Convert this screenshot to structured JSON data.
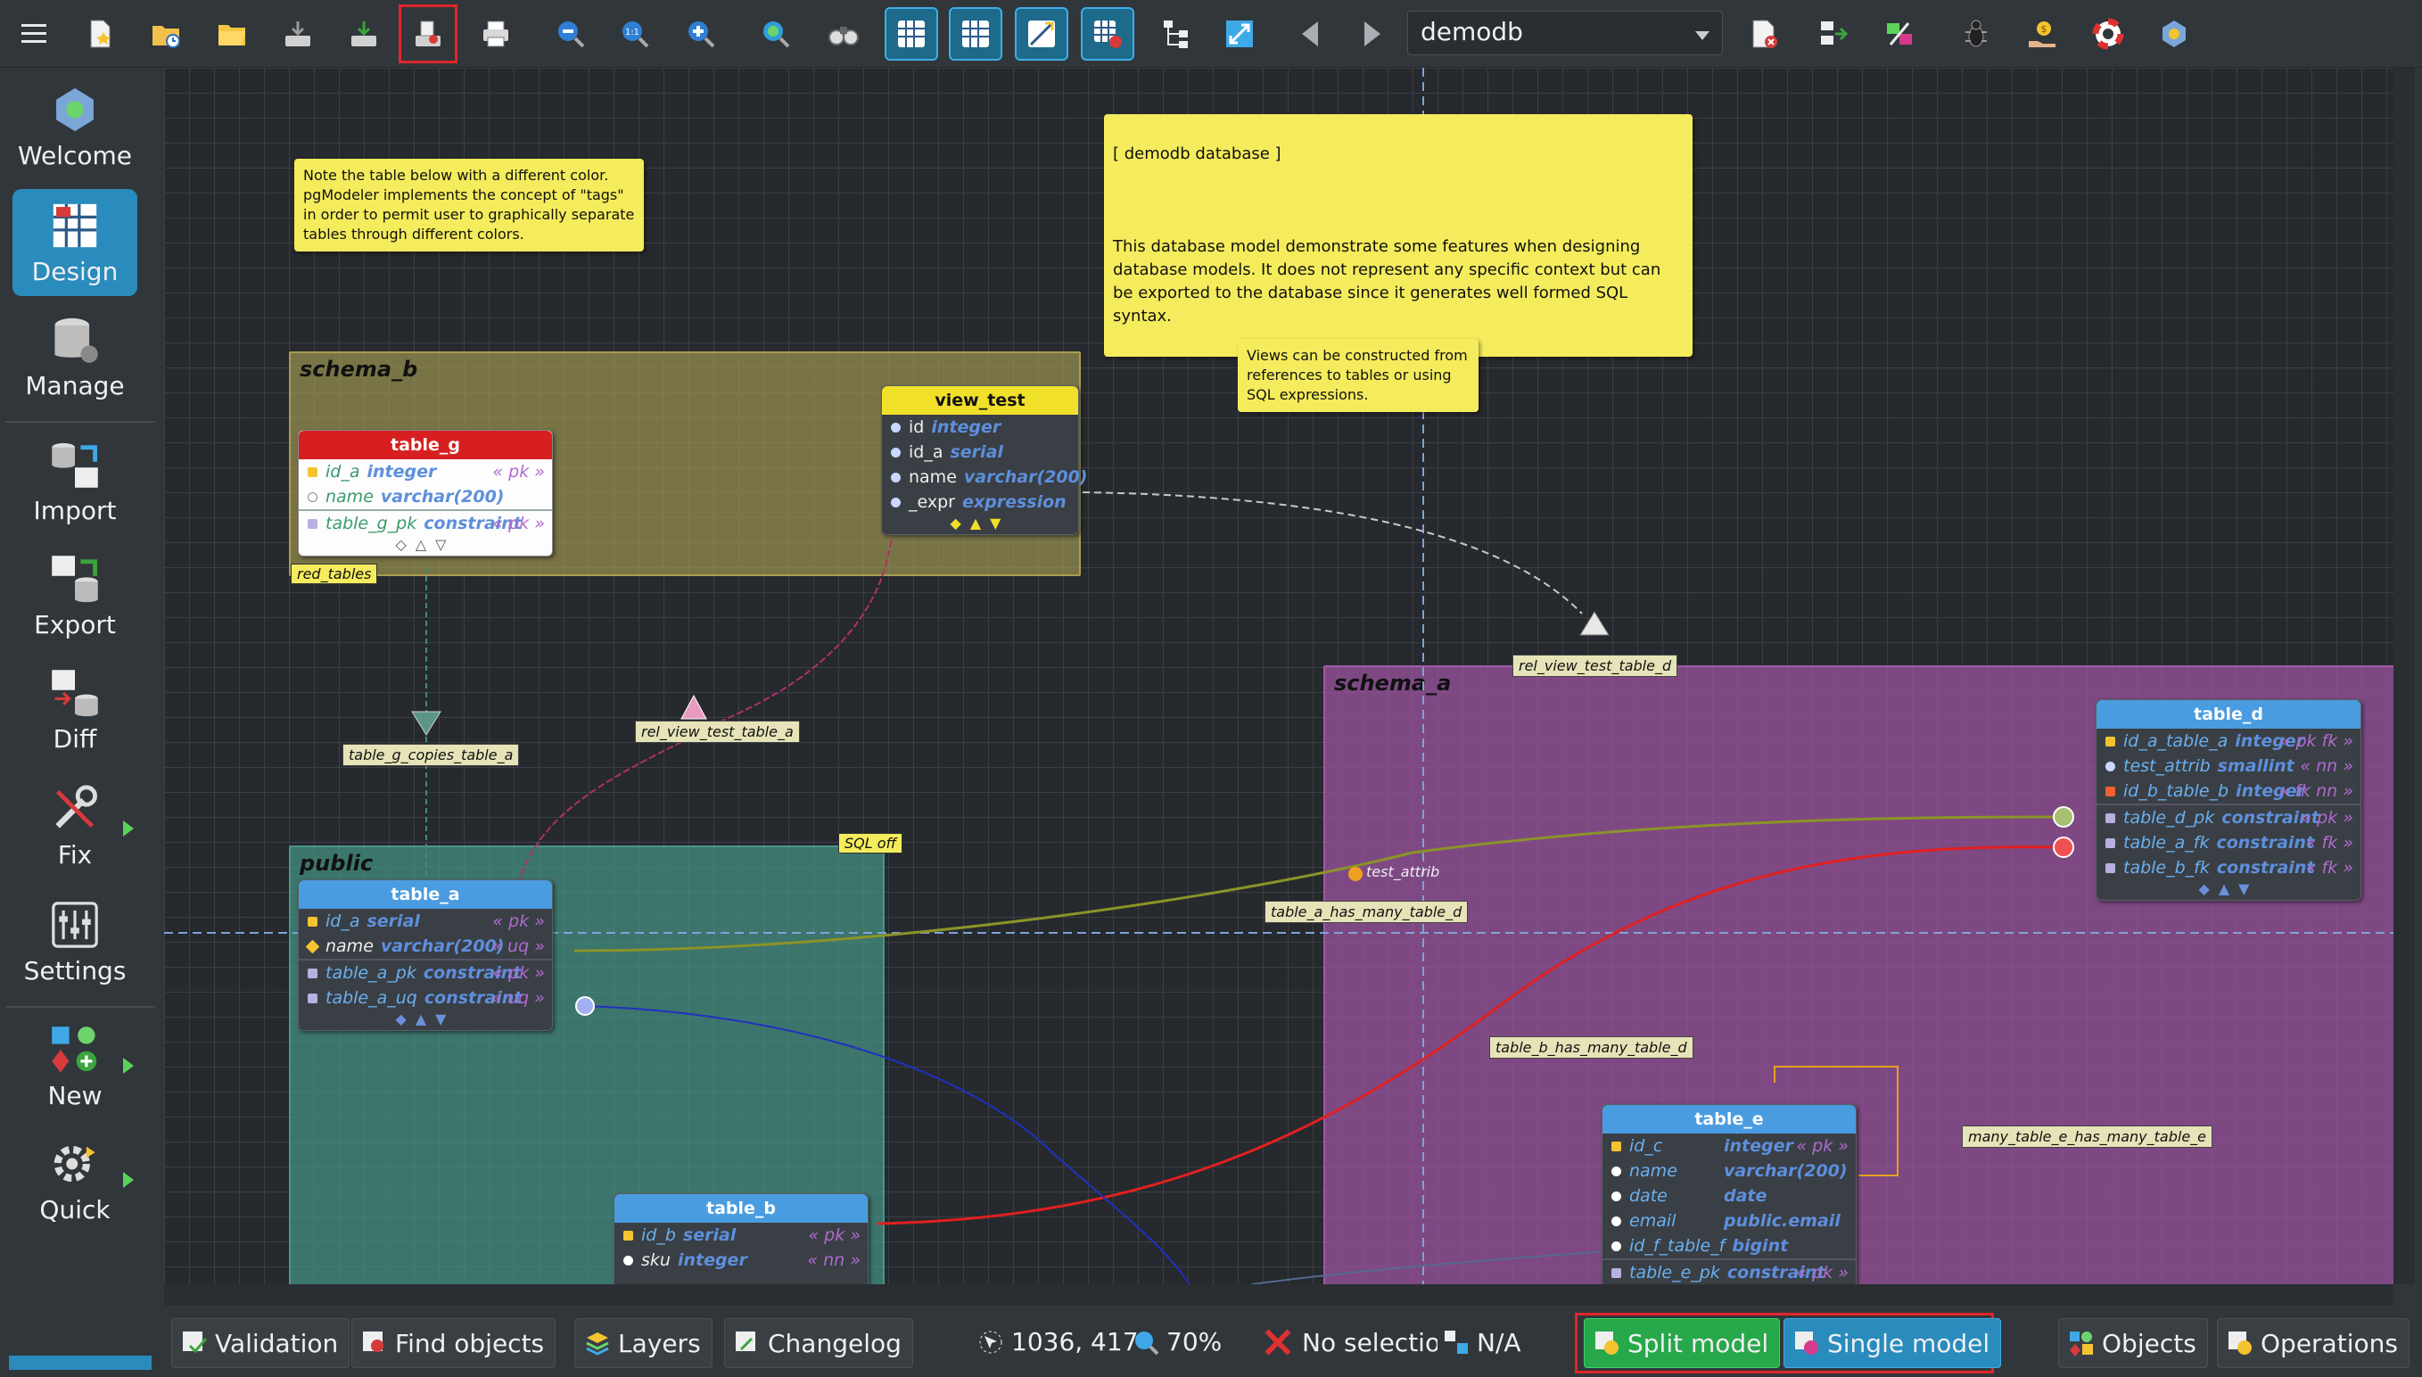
{
  "toolbar": {
    "buttons": [
      "menu-icon",
      "new-model-icon",
      "open-recent-icon",
      "open-icon",
      "save-icon",
      "save-as-icon",
      "export-icon",
      "print-icon",
      "zoom-out-icon",
      "zoom-reset-icon",
      "zoom-in-icon",
      "zoom-fit-icon",
      "find-icon",
      "show-grid-icon",
      "align-grid-icon",
      "show-delimiters-icon",
      "overview-icon",
      "arrange-icon",
      "fit-icon",
      "previous-model-icon",
      "next-model-icon"
    ],
    "database": "demodb"
  },
  "sidebar": {
    "items": [
      {
        "label": "Welcome"
      },
      {
        "label": "Design"
      },
      {
        "label": "Manage"
      },
      {
        "label": "Import"
      },
      {
        "label": "Export"
      },
      {
        "label": "Diff"
      },
      {
        "label": "Fix"
      },
      {
        "label": "Settings"
      },
      {
        "label": "New"
      },
      {
        "label": "Quick"
      }
    ]
  },
  "canvas": {
    "notes": {
      "tags_note": "Note the table below with a different color.\npgModeler implements the concept of \"tags\"\nin order to permit user to graphically separate\ntables through different colors.",
      "db_note_title": "[ demodb database ]",
      "db_note_body": "This database model demonstrate some features when designing\ndatabase models. It does not represent any specific context but can\nbe exported to the database since it generates well formed SQL syntax.",
      "views_note": "Views can be constructed from\nreferences to tables or using\nSQL expressions."
    },
    "schemas": {
      "schema_b": "schema_b",
      "schema_a": "schema_a",
      "public": "public"
    },
    "tables": {
      "table_g": {
        "name": "table_g",
        "rows": [
          {
            "name": "id_a",
            "type": "integer",
            "tag": "« pk »"
          },
          {
            "name": "name",
            "type": "varchar(200)",
            "tag": ""
          },
          {
            "name": "table_g_pk",
            "type": "constraint",
            "tag": "« pk »"
          }
        ]
      },
      "view_test": {
        "name": "view_test",
        "rows": [
          {
            "name": "id",
            "type": "integer",
            "tag": ""
          },
          {
            "name": "id_a",
            "type": "serial",
            "tag": ""
          },
          {
            "name": "name",
            "type": "varchar(200)",
            "tag": ""
          },
          {
            "name": "_expr",
            "type": "expression",
            "tag": ""
          }
        ]
      },
      "table_a": {
        "name": "table_a",
        "rows": [
          {
            "name": "id_a",
            "type": "serial",
            "tag": "« pk »"
          },
          {
            "name": "name",
            "type": "varchar(200)",
            "tag": "« uq »"
          },
          {
            "name": "table_a_pk",
            "type": "constraint",
            "tag": "« pk »"
          },
          {
            "name": "table_a_uq",
            "type": "constraint",
            "tag": "« uq »"
          }
        ]
      },
      "table_b": {
        "name": "table_b",
        "rows": [
          {
            "name": "id_b",
            "type": "serial",
            "tag": "« pk »"
          },
          {
            "name": "sku",
            "type": "integer",
            "tag": "« nn »"
          }
        ]
      },
      "table_d": {
        "name": "table_d",
        "rows": [
          {
            "name": "id_a_table_a",
            "type": "integer",
            "tag": "« pk fk »"
          },
          {
            "name": "test_attrib",
            "type": "smallint",
            "tag": "« nn »"
          },
          {
            "name": "id_b_table_b",
            "type": "integer",
            "tag": "« fk nn »"
          },
          {
            "name": "table_d_pk",
            "type": "constraint",
            "tag": "« pk »"
          },
          {
            "name": "table_a_fk",
            "type": "constraint",
            "tag": "« fk »"
          },
          {
            "name": "table_b_fk",
            "type": "constraint",
            "tag": "« fk »"
          }
        ]
      },
      "table_e": {
        "name": "table_e",
        "rows": [
          {
            "name": "id_c",
            "type": "integer",
            "tag": "« pk »"
          },
          {
            "name": "name",
            "type": "varchar(200)",
            "tag": ""
          },
          {
            "name": "date",
            "type": "date",
            "tag": ""
          },
          {
            "name": "email",
            "type": "public.email",
            "tag": ""
          },
          {
            "name": "id_f_table_f",
            "type": "bigint",
            "tag": ""
          },
          {
            "name": "table_e_pk",
            "type": "constraint",
            "tag": "« pk »"
          }
        ]
      }
    },
    "labels": {
      "red_tables": "red_tables",
      "sql_off": "SQL off",
      "rel_view_test_table_a": "rel_view_test_table_a",
      "rel_view_test_table_d": "rel_view_test_table_d",
      "table_g_copies_table_a": "table_g_copies_table_a",
      "table_a_has_many_table_d": "table_a_has_many_table_d",
      "test_attrib": "test_attrib",
      "table_b_has_many_table_d": "table_b_has_many_table_d",
      "many_table_e_has_many_table_e": "many_table_e_has_many_table_e"
    }
  },
  "statusbar": {
    "validation": "Validation",
    "find_objects": "Find objects",
    "layers": "Layers",
    "changelog": "Changelog",
    "position": "1036, 417",
    "zoom": "70%",
    "selection": "No selection",
    "selection_size": "N/A",
    "split_model": "Split model",
    "single_model": "Single model",
    "objects": "Objects",
    "operations": "Operations"
  },
  "colors": {
    "accent": "#3daee9",
    "schema_b": "#8c8447",
    "schema_a": "#8b4e8f",
    "public": "#3f7f74",
    "table_g_header": "#d81f1f",
    "view_header": "#f1e02a",
    "table_header": "#4a9ce0"
  }
}
